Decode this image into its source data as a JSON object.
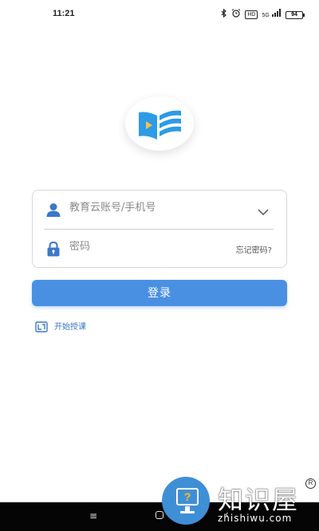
{
  "status_bar": {
    "time": "11:21",
    "hd_label": "HD",
    "signal_label": "5G",
    "battery_level": "94",
    "icons": [
      "bluetooth-icon",
      "alarm-icon",
      "hd-icon",
      "signal-icon",
      "battery-icon"
    ]
  },
  "app": {
    "logo_icon": "education-cloud-logo-icon",
    "brand_colors": {
      "primary": "#4a90e2",
      "logo_blue": "#2d9be6",
      "logo_yellow": "#f2c14a"
    }
  },
  "login_form": {
    "account_placeholder": "教育云账号/手机号",
    "account_value": "",
    "account_icon": "user-icon",
    "dropdown_icon": "chevron-down-icon",
    "password_placeholder": "密码",
    "password_value": "",
    "password_icon": "lock-icon",
    "forgot_label": "忘记密码?"
  },
  "login_button": {
    "label": "登录"
  },
  "start_teaching": {
    "label": "开始授课",
    "icon": "teaching-icon"
  },
  "nav_bar": {
    "menu_glyph": "≡",
    "back_glyph": "‹",
    "icons": [
      "menu-icon",
      "home-icon",
      "back-icon"
    ]
  },
  "watermark": {
    "title": "知识屋",
    "url": "zhishiwu.com",
    "reg_mark": "R",
    "icon_glyph": "?"
  }
}
